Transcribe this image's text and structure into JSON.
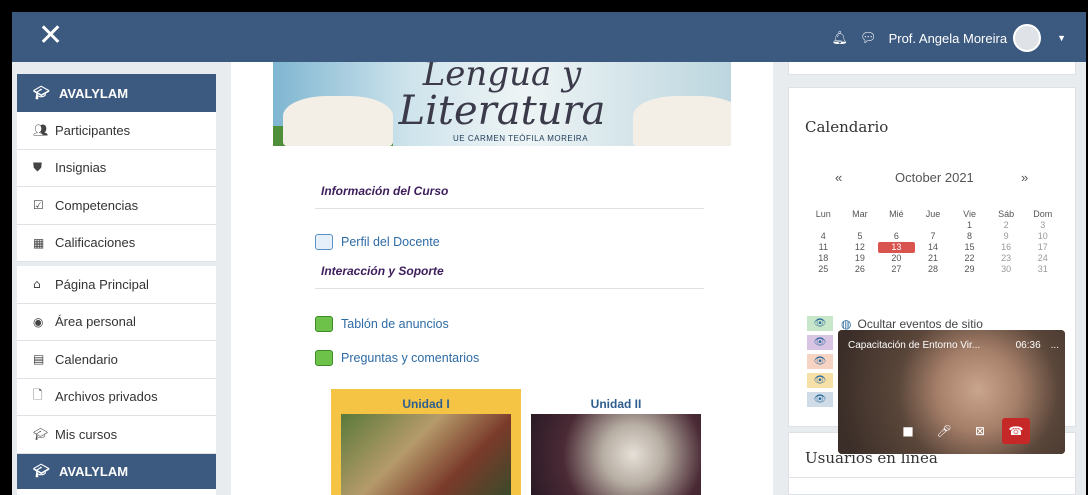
{
  "navbar": {
    "close_icon": "close-icon",
    "user_name": "Prof. Angela Moreira",
    "bell_icon": "bell-icon",
    "chat_icon": "chat-icon"
  },
  "sidebar": {
    "course_label": "AVALYLAM",
    "items": [
      {
        "label": "Participantes",
        "icon": "users-icon"
      },
      {
        "label": "Insignias",
        "icon": "shield-icon"
      },
      {
        "label": "Competencias",
        "icon": "checkbox-icon"
      },
      {
        "label": "Calificaciones",
        "icon": "table-icon"
      }
    ],
    "items2": [
      {
        "label": "Página Principal",
        "icon": "home-icon"
      },
      {
        "label": "Área personal",
        "icon": "dashboard-icon"
      },
      {
        "label": "Calendario",
        "icon": "calendar-icon"
      },
      {
        "label": "Archivos privados",
        "icon": "file-icon"
      },
      {
        "label": "Mis cursos",
        "icon": "graduation-cap-icon"
      }
    ],
    "bottom_label": "AVALYLAM"
  },
  "main": {
    "banner": {
      "line1": "Lengua y",
      "line2": "Literatura",
      "subtitle": "UE CARMEN TEÓFILA MOREIRA"
    },
    "section1": "Información del Curso",
    "perfil": "Perfil del Docente",
    "section2": "Interacción y Soporte",
    "tablon": "Tablón de anuncios",
    "preguntas": "Preguntas y comentarios",
    "unit1": "Unidad I",
    "unit2": "Unidad II"
  },
  "calendar": {
    "title": "Calendario",
    "month": "October 2021",
    "prev": "«",
    "next": "»",
    "days": [
      "Lun",
      "Mar",
      "Mié",
      "Jue",
      "Vie",
      "Sáb",
      "Dom"
    ],
    "weeks": [
      [
        "",
        "",
        "",
        "",
        "1",
        "2",
        "3"
      ],
      [
        "4",
        "5",
        "6",
        "7",
        "8",
        "9",
        "10"
      ],
      [
        "11",
        "12",
        "13",
        "14",
        "15",
        "16",
        "17"
      ],
      [
        "18",
        "19",
        "20",
        "21",
        "22",
        "23",
        "24"
      ],
      [
        "25",
        "26",
        "27",
        "28",
        "29",
        "30",
        "31"
      ]
    ],
    "today": "13",
    "event_toggle": "Ocultar eventos de sitio"
  },
  "online": {
    "title": "Usuarios en línea"
  },
  "video": {
    "title": "Capacitación de Entorno Vir...",
    "time": "06:36",
    "menu": "..."
  },
  "colors": {
    "navbar": "#3c5a80",
    "accent": "#d9534f"
  }
}
